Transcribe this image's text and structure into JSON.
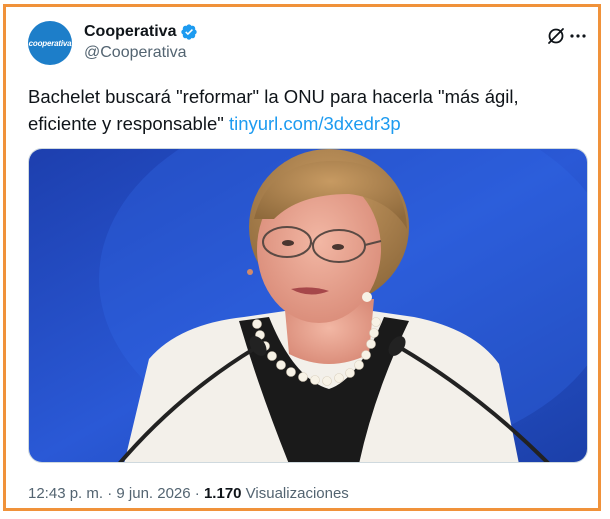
{
  "account": {
    "avatar_text": "cooperativa",
    "display_name": "Cooperativa",
    "handle": "@Cooperativa",
    "verified": true
  },
  "tweet": {
    "text": "Bachelet buscará \"reformar\" la ONU para hacerla \"más ágil, eficiente y responsable\" ",
    "link": "tinyurl.com/3dxedr3p"
  },
  "media": {
    "icon": "photo-woman-speaking-at-podium"
  },
  "meta": {
    "time": "12:43 p. m.",
    "sep1": " · ",
    "date": "9 jun. 2026",
    "sep2": " · ",
    "views_count": "1.170",
    "views_label": " Visualizaciones"
  },
  "colors": {
    "accent": "#1d9bf0",
    "frame": "#f0923a",
    "avatar_bg": "#1d7ec9"
  }
}
